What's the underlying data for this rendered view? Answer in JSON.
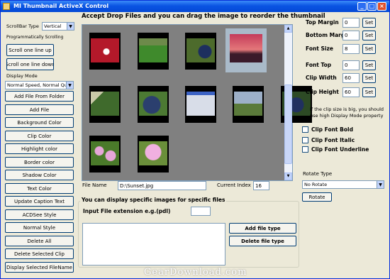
{
  "window": {
    "title": "MI Thumbnail ActiveX Control",
    "controls": [
      "_",
      "□",
      "×"
    ]
  },
  "left": {
    "scrollbar_type_label": "ScrollBar Type",
    "scrollbar_type_value": "Vertical",
    "programmatic_label": "Programmatically Scrolling",
    "scroll_up": "Scroll one line up",
    "scroll_down": "Scroll one line down",
    "display_mode_label": "Display Mode",
    "display_mode_value": "Normal Speed, Normal Quality",
    "buttons": [
      "Add File From Folder",
      "Add File",
      "Background Color",
      "Clip Color",
      "Highlight color",
      "Border color",
      "Shadow Color",
      "Text Color",
      "Update Caption Text",
      "ACDSee Style",
      "Normal Style",
      "Delete All",
      "Delete Selected Clip",
      "Display Selected FileName"
    ]
  },
  "header": {
    "text": "Accept Drop Files and you can drag the image to reorder the thumbnail"
  },
  "viewer": {
    "thumbs": [
      {
        "name": "thumb-soccer-1",
        "color": "#b4192a"
      },
      {
        "name": "thumb-soccer-2",
        "color": "#3f8a2c"
      },
      {
        "name": "thumb-soccer-3",
        "color": "#4d6b2c"
      },
      {
        "name": "thumb-sunset",
        "color": "#d05a50"
      },
      {
        "name": "thumb-soccer-4",
        "color": "#3f6a2c"
      },
      {
        "name": "thumb-soccer-5",
        "color": "#2b3f6e"
      },
      {
        "name": "thumb-screenshot",
        "color": "#6b7b9c"
      },
      {
        "name": "thumb-stadium",
        "color": "#8fa3a8"
      },
      {
        "name": "thumb-soccer-6",
        "color": "#2d4a25"
      },
      {
        "name": "thumb-lilies-1",
        "color": "#6b8f4a"
      },
      {
        "name": "thumb-lilies-2",
        "color": "#c06cb0"
      }
    ]
  },
  "file": {
    "name_label": "File Name",
    "name_value": "D:\\Sunset.jpg",
    "index_label": "Current Index",
    "index_value": "16"
  },
  "specific": {
    "title": "You can display specific images for specific files",
    "ext_label": "Input File extension e.g.(pdl)",
    "ext_value": "",
    "add_btn": "Add file type",
    "delete_btn": "Delete file type"
  },
  "right": {
    "fields": [
      {
        "label": "Top Margin",
        "value": "0",
        "set": "Set"
      },
      {
        "label": "Bottom Margin",
        "value": "0",
        "set": "Set"
      },
      {
        "label": "Font Size",
        "value": "8",
        "set": "Set"
      },
      {
        "label": "Font Top",
        "value": "0",
        "set": "Set"
      },
      {
        "label": "Clip Width",
        "value": "60",
        "set": "Set"
      },
      {
        "label": "Clip Height",
        "value": "60",
        "set": "Set"
      }
    ],
    "note": "If the clip size is big, you should use high Display Mode property",
    "checks": [
      "Clip Font Bold",
      "Clip Font Italic",
      "Clip Font Underline"
    ],
    "rotate_label": "Rotate Type",
    "rotate_value": "No Rotate",
    "rotate_btn": "Rotate"
  },
  "watermark": "GearDownload.com"
}
